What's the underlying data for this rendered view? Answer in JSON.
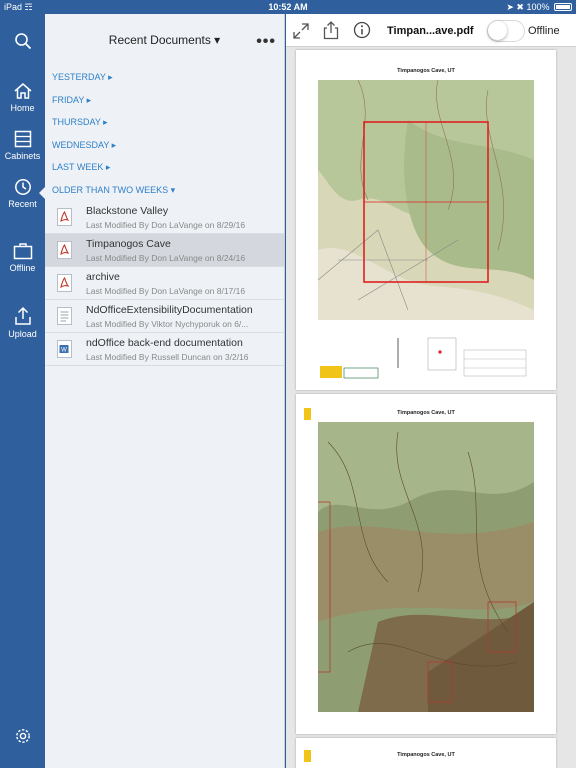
{
  "status_bar": {
    "device": "iPad",
    "time": "10:52 AM",
    "battery": "100%"
  },
  "nav_rail": {
    "items": [
      {
        "label": "",
        "icon": "search-icon"
      },
      {
        "label": "Home",
        "icon": "home-icon"
      },
      {
        "label": "Cabinets",
        "icon": "cabinets-icon"
      },
      {
        "label": "Recent",
        "icon": "clock-icon",
        "active": true
      },
      {
        "label": "Offline",
        "icon": "briefcase-icon"
      },
      {
        "label": "Upload",
        "icon": "upload-icon"
      },
      {
        "label": "",
        "icon": "settings-icon"
      }
    ]
  },
  "documents_panel": {
    "title": "Recent Documents ▾",
    "more": "•••",
    "sections": [
      {
        "label": "YESTERDAY ▸"
      },
      {
        "label": "FRIDAY ▸"
      },
      {
        "label": "THURSDAY ▸"
      },
      {
        "label": "WEDNESDAY ▸"
      },
      {
        "label": "LAST WEEK ▸"
      },
      {
        "label": "OLDER THAN TWO WEEKS ▾"
      }
    ],
    "documents": [
      {
        "name": "Blackstone Valley",
        "meta": "Last Modified By Don LaVange on 8/29/16",
        "type": "pdf"
      },
      {
        "name": "Timpanogos Cave",
        "meta": "Last Modified By Don LaVange on 8/24/16",
        "type": "pdf",
        "selected": true
      },
      {
        "name": "archive",
        "meta": "Last Modified By Don LaVange on 8/17/16",
        "type": "pdf"
      },
      {
        "name": "NdOfficeExtensibilityDocumentation",
        "meta": "Last Modified By Viktor Nychyporuk on 6/...",
        "type": "doc"
      },
      {
        "name": "ndOffice back-end documentation",
        "meta": "Last Modified By Russell Duncan on 3/2/16",
        "type": "word"
      }
    ]
  },
  "viewer": {
    "filename": "Timpan...ave.pdf",
    "offline_label": "Offline",
    "offline_toggle_on": false,
    "pages": [
      {
        "header": "Timpanogos Cave, UT"
      },
      {
        "header": "Timpanogos Cave, UT"
      },
      {
        "header": "Timpanogos Cave, UT"
      }
    ]
  },
  "colors": {
    "rail_blue": "#2f5f9c",
    "section_link": "#2f7fc7",
    "pdf_icon_red": "#c0392b",
    "map_red_box": "#e02020"
  }
}
